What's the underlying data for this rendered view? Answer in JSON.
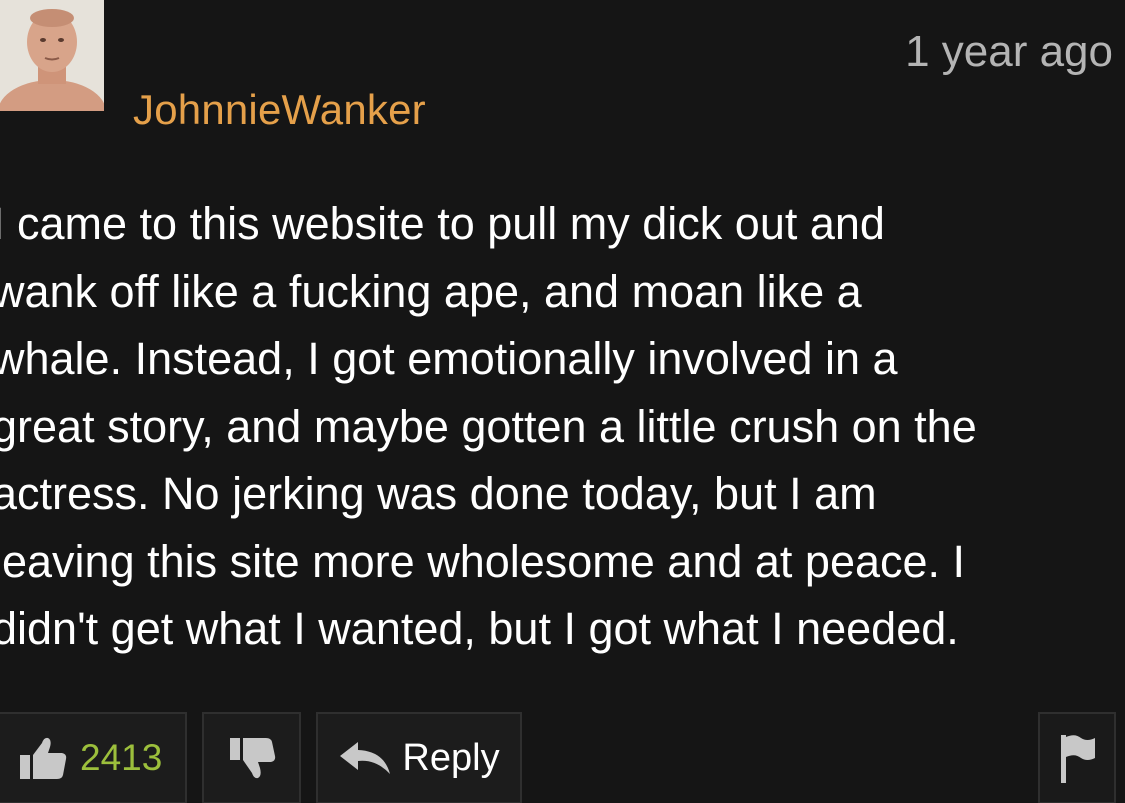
{
  "comment": {
    "username": "JohnnieWanker",
    "timestamp": "1 year ago",
    "lines": [
      "I came to this website to pull my dick out and",
      "wank off like a fucking ape, and moan like a",
      "whale. Instead, I got emotionally involved in a",
      "great story, and maybe gotten a little crush on the",
      "actress. No jerking was done today, but I am",
      "leaving this site more wholesome and at peace. I",
      "didn't get what I wanted, but I got what I needed."
    ]
  },
  "actions": {
    "like_count": "2413",
    "reply_label": "Reply"
  },
  "icons": {
    "like": "thumbs-up-icon",
    "dislike": "thumbs-down-icon",
    "reply": "reply-arrow-icon",
    "flag": "flag-icon"
  },
  "colors": {
    "background": "#151515",
    "username": "#e5a04a",
    "timestamp": "#b4b4b4",
    "like_count": "#9cbf3c",
    "button_bg": "#1c1c1c",
    "button_border": "#2f2f2f",
    "icon": "#c8c8c8"
  }
}
